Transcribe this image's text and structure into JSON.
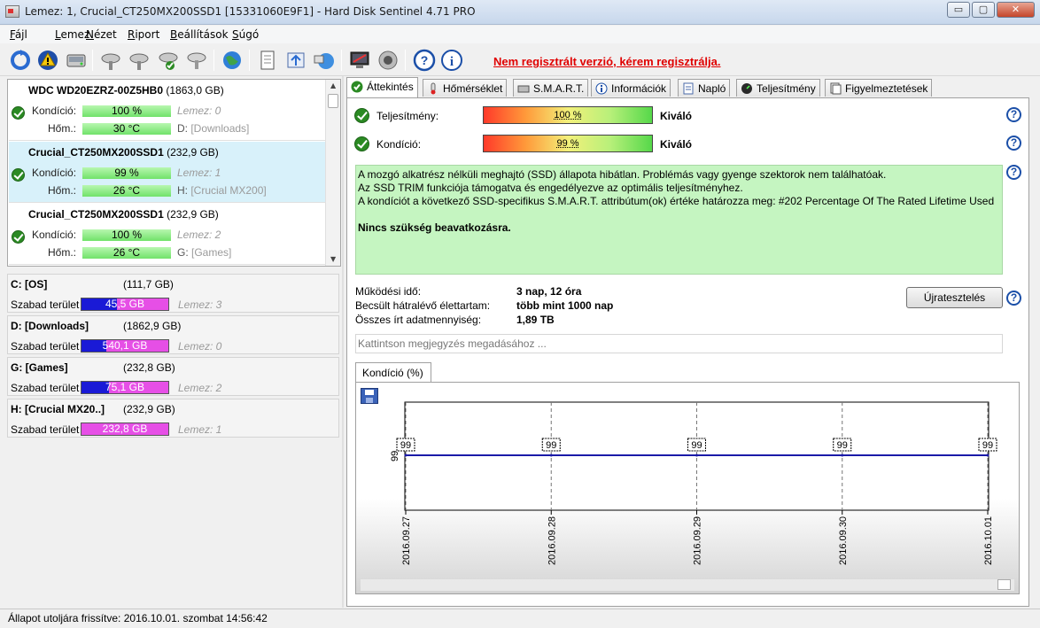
{
  "window": {
    "title": "Lemez: 1, Crucial_CT250MX200SSD1 [15331060E9F1]  -  Hard Disk Sentinel 4.71 PRO",
    "min_glyph": "▭",
    "max_glyph": "▢",
    "close_glyph": "✕"
  },
  "menu": [
    "Fájl",
    "Lemez",
    "Nézet",
    "Riport",
    "Beállítások",
    "Súgó"
  ],
  "toolbar": {
    "icons": [
      "refresh-icon",
      "warning-icon",
      "disk-icon",
      "disk-check-icon",
      "disk-check-icon",
      "disk-ok-icon",
      "disk-settings-icon",
      "globe-icon",
      "document-icon",
      "send-icon",
      "network-icon",
      "monitor-icon",
      "sound-icon",
      "help-icon",
      "info-icon"
    ],
    "registration_notice": "Nem regisztrált verzió, kérem regisztrálja."
  },
  "disks": [
    {
      "name": "WDC WD20EZRZ-00Z5HB0",
      "size": "(1863,0 GB)",
      "condition_label": "Kondíció:",
      "condition": "100 %",
      "disk_label": "Lemez: 0",
      "temp_label": "Hőm.:",
      "temp": "30 °C",
      "drive_letter": "D:",
      "drive_name": "[Downloads]",
      "selected": false
    },
    {
      "name": "Crucial_CT250MX200SSD1",
      "size": "(232,9 GB)",
      "condition_label": "Kondíció:",
      "condition": "99 %",
      "disk_label": "Lemez: 1",
      "temp_label": "Hőm.:",
      "temp": "26 °C",
      "drive_letter": "H:",
      "drive_name": "[Crucial MX200]",
      "selected": true
    },
    {
      "name": "Crucial_CT250MX200SSD1",
      "size": "(232,9 GB)",
      "condition_label": "Kondíció:",
      "condition": "100 %",
      "disk_label": "Lemez: 2",
      "temp_label": "Hőm.:",
      "temp": "26 °C",
      "drive_letter": "G:",
      "drive_name": "[Games]",
      "selected": false
    }
  ],
  "partitions": [
    {
      "name": "C: [OS]",
      "size": "(111,7 GB)",
      "free_label": "Szabad terület",
      "free": "45,5 GB",
      "free_fraction": 0.41,
      "disk": "Lemez: 3"
    },
    {
      "name": "D: [Downloads]",
      "size": "(1862,9 GB)",
      "free_label": "Szabad terület",
      "free": "540,1 GB",
      "free_fraction": 0.29,
      "disk": "Lemez: 0"
    },
    {
      "name": "G: [Games]",
      "size": "(232,8 GB)",
      "free_label": "Szabad terület",
      "free": "75,1 GB",
      "free_fraction": 0.32,
      "disk": "Lemez: 2"
    },
    {
      "name": "H: [Crucial MX20..]",
      "size": "(232,9 GB)",
      "free_label": "Szabad terület",
      "free": "232,8 GB",
      "free_fraction": 1.0,
      "disk": "Lemez: 1"
    }
  ],
  "tabs": [
    {
      "label": "Áttekintés",
      "icon": "check-icon",
      "active": true
    },
    {
      "label": "Hőmérséklet",
      "icon": "thermometer-icon",
      "active": false
    },
    {
      "label": "S.M.A.R.T.",
      "icon": "smart-icon",
      "active": false
    },
    {
      "label": "Információk",
      "icon": "info-icon",
      "active": false
    },
    {
      "label": "Napló",
      "icon": "log-icon",
      "active": false
    },
    {
      "label": "Teljesítmény",
      "icon": "gauge-icon",
      "active": false
    },
    {
      "label": "Figyelmeztetések",
      "icon": "alerts-icon",
      "active": false
    }
  ],
  "overview": {
    "performance": {
      "label": "Teljesítmény:",
      "value": "100 %",
      "rating": "Kiváló"
    },
    "health": {
      "label": "Kondíció:",
      "value": "99 %",
      "rating": "Kiváló"
    },
    "info_lines": [
      "A mozgó alkatrész nélküli meghajtó (SSD) állapota hibátlan. Problémás vagy gyenge szektorok nem találhatóak.",
      "Az SSD TRIM funkciója támogatva és engedélyezve az optimális teljesítményhez.",
      "A kondíciót a következő SSD-specifikus S.M.A.R.T. attribútum(ok) értéke határozza meg:  #202 Percentage Of The Rated Lifetime Used"
    ],
    "info_action": "Nincs szükség beavatkozásra.",
    "uptime_label": "Működési idő:",
    "uptime": "3 nap, 12 óra",
    "remaining_label": "Becsült hátralévő élettartam:",
    "remaining": "több mint 1000 nap",
    "written_label": "Összes írt adatmennyiség:",
    "written": "1,89 TB",
    "retest_button": "Újratesztelés",
    "note_placeholder": "Kattintson megjegyzés megadásához ...",
    "help_glyph": "?"
  },
  "chart_tab": "Kondíció  (%)",
  "chart_data": {
    "type": "line",
    "x": [
      "2016.09.27",
      "2016.09.28",
      "2016.09.29",
      "2016.09.30",
      "2016.10.01"
    ],
    "values": [
      99,
      99,
      99,
      99,
      99
    ],
    "data_labels": [
      "99",
      "99",
      "99",
      "99",
      "99"
    ],
    "y_tick": "99",
    "color": "#1a1aa8",
    "grid": "vertical dashed"
  },
  "statusbar": "Állapot utoljára frissítve: 2016.10.01. szombat 14:56:42"
}
